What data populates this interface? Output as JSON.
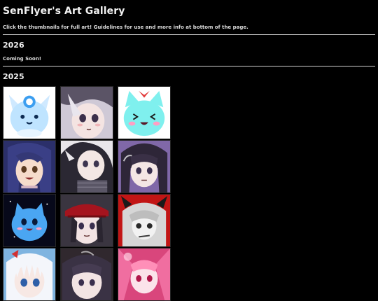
{
  "page": {
    "title": "SenFlyer's Art Gallery",
    "note": "Click the thumbnails for full art! Guidelines for use and more info at bottom of the page."
  },
  "sections": [
    {
      "year": "2026",
      "status": "Coming Soon!"
    },
    {
      "year": "2025"
    }
  ],
  "thumbnails_2025": [
    {
      "subject": "blue-spirit-creature-icon",
      "bg": "#ffffff"
    },
    {
      "subject": "silver-haired-girl-portrait",
      "bg": "#d8d2dd"
    },
    {
      "subject": "cyan-cat-creature-icon",
      "bg": "#ffffff"
    },
    {
      "subject": "brunette-girl-portrait",
      "bg": "#2b2f6a"
    },
    {
      "subject": "hooded-character-portrait",
      "bg": "#e9e6ea"
    },
    {
      "subject": "dark-haired-character-portrait",
      "bg": "#8068a8"
    },
    {
      "subject": "blue-cat-creature-icon",
      "bg": "#07091a"
    },
    {
      "subject": "red-hat-character-portrait",
      "bg": "#3a3540"
    },
    {
      "subject": "horned-character-portrait",
      "bg": "#c21515"
    },
    {
      "subject": "white-haired-girl-portrait",
      "bg": "#7fb4e0"
    },
    {
      "subject": "dark-haired-girl-portrait",
      "bg": "#30282e"
    },
    {
      "subject": "pink-character-portrait",
      "bg": "#e05a8c"
    }
  ]
}
